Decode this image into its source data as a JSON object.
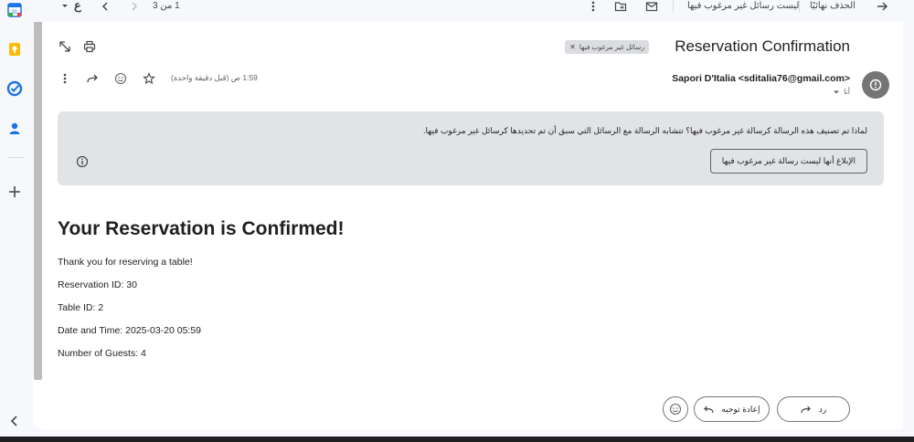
{
  "rail": {
    "icons": [
      "calendar-icon",
      "keep-icon",
      "tasks-icon",
      "contacts-icon",
      "add-icon",
      "collapse-icon"
    ]
  },
  "toolbar": {
    "pagination": "1 من 3",
    "translate_glyph": "ع",
    "not_spam_label": "ليست رسائل غير مرغوب فيها",
    "delete_forever_label": "الحذف نهائيًا"
  },
  "email": {
    "subject": "Reservation Confirmation",
    "label_chip": "رسائل غير مرغوب فيها",
    "sender": "Sapori D'Italia <sditalia76@gmail.com>",
    "to": "أنا",
    "timestamp": "1:59 ص (قبل دقيقة واحدة)"
  },
  "spam_notice": {
    "text": "لماذا تم تصنيف هذه الرسالة كرسالة غير مرغوب فيها؟ تتشابه الرسالة مع الرسائل التي سبق أن تم تحديدها كرسائل غير مرغوب فيها.",
    "button": "الإبلاغ أنها ليست رسالة غير مرغوب فيها"
  },
  "body": {
    "heading": "Your Reservation is Confirmed!",
    "lines": [
      "Thank you for reserving a table!",
      "Reservation ID: 30",
      "Table ID: 2",
      "Date and Time: 2025-03-20 05:59",
      "Number of Guests: 4"
    ]
  },
  "actions": {
    "reply": "رد",
    "forward": "إعادة توجيه"
  },
  "colors": {
    "background": "#f6f8fc",
    "panel": "#ffffff",
    "spam_box": "#e1e3e6",
    "avatar": "#757575",
    "accent_blue": "#1a73e8"
  }
}
